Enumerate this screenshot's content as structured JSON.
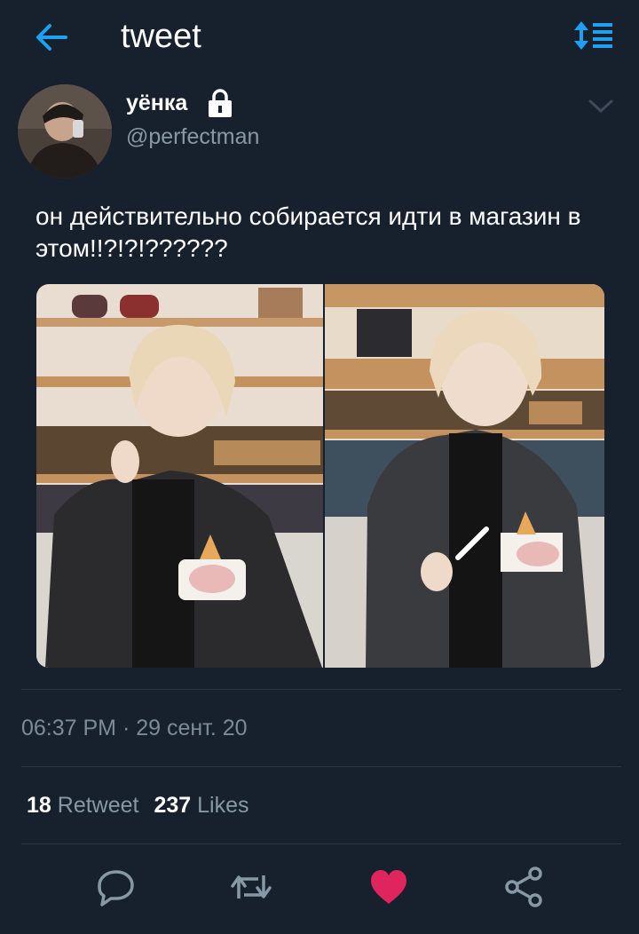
{
  "header": {
    "title": "tweet",
    "back_icon": "arrow-left-icon",
    "sort_icon": "sort-icon",
    "accent": "#1da1f2"
  },
  "tweet": {
    "author": {
      "name": "уёнка",
      "handle": "@perfectman",
      "protected_icon": "lock-icon"
    },
    "text": "он действительно собирается идти в магазин в этом!!?!?!??????",
    "media": [
      {
        "description_icon": "photo"
      },
      {
        "description_icon": "photo"
      }
    ],
    "timestamp": "06:37 PM · 29 сент. 20",
    "stats": {
      "retweets_count": "18",
      "retweets_label": "Retweet",
      "likes_count": "237",
      "likes_label": "Likes"
    },
    "actions": [
      {
        "icon": "reply-icon"
      },
      {
        "icon": "retweet-icon"
      },
      {
        "icon": "heart-icon",
        "active": true,
        "color": "#e0245e"
      },
      {
        "icon": "share-icon"
      }
    ]
  },
  "colors": {
    "background": "#17202d",
    "secondary_text": "#8899a6",
    "divider": "#2b3746"
  }
}
